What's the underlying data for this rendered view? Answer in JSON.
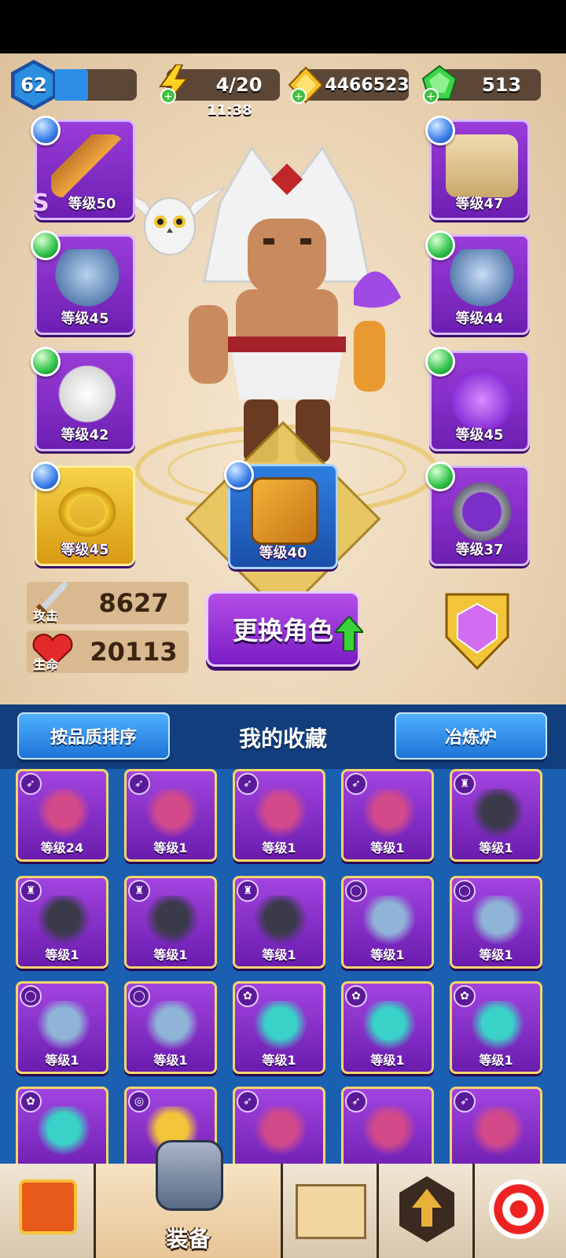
{
  "player": {
    "level": "62",
    "xp_fraction": 0.4
  },
  "resources": {
    "energy": {
      "value": "4/20",
      "timer": "11:38",
      "icon": "energy-bolt-icon"
    },
    "gold": {
      "value": "4466523",
      "icon": "coin-icon"
    },
    "gems": {
      "value": "513",
      "icon": "gem-icon"
    }
  },
  "equipment": {
    "left": [
      {
        "level": "等级50",
        "rarity": "S",
        "icon": "bow-icon",
        "orb": "blue",
        "frame": "purple"
      },
      {
        "level": "等级45",
        "icon": "bull-ring-icon",
        "orb": "green",
        "frame": "purple"
      },
      {
        "level": "等级42",
        "icon": "owl-pet-icon",
        "orb": "green",
        "frame": "purple"
      },
      {
        "level": "等级45",
        "icon": "gold-bracelet-icon",
        "orb": "blue",
        "frame": "gold"
      }
    ],
    "right": [
      {
        "level": "等级47",
        "icon": "armor-icon",
        "orb": "blue",
        "frame": "purple"
      },
      {
        "level": "等级44",
        "icon": "wolf-ring-icon",
        "orb": "green",
        "frame": "purple"
      },
      {
        "level": "等级45",
        "icon": "flame-pet-icon",
        "orb": "green",
        "frame": "purple"
      },
      {
        "level": "等级37",
        "icon": "medallion-icon",
        "orb": "green",
        "frame": "purple"
      }
    ],
    "center": {
      "level": "等级40",
      "icon": "spellbook-icon",
      "orb": "blue",
      "frame": "blue"
    }
  },
  "stats": {
    "attack": {
      "label": "攻击",
      "value": "8627"
    },
    "health": {
      "label": "生命",
      "value": "20113"
    }
  },
  "change_character": "更换角色",
  "collection": {
    "sort_button": "按品质排序",
    "title": "我的收藏",
    "forge_button": "冶炼炉",
    "items": [
      {
        "level": "等级24",
        "type": "bow"
      },
      {
        "level": "等级1",
        "type": "bow"
      },
      {
        "level": "等级1",
        "type": "bow"
      },
      {
        "level": "等级1",
        "type": "bow"
      },
      {
        "level": "等级1",
        "type": "armor"
      },
      {
        "level": "等级1",
        "type": "armor"
      },
      {
        "level": "等级1",
        "type": "armor"
      },
      {
        "level": "等级1",
        "type": "armor"
      },
      {
        "level": "等级1",
        "type": "ring"
      },
      {
        "level": "等级1",
        "type": "ring"
      },
      {
        "level": "等级1",
        "type": "ring"
      },
      {
        "level": "等级1",
        "type": "ring"
      },
      {
        "level": "等级1",
        "type": "pet"
      },
      {
        "level": "等级1",
        "type": "pet"
      },
      {
        "level": "等级1",
        "type": "pet"
      },
      {
        "level": "",
        "type": "pet"
      },
      {
        "level": "",
        "type": "bracelet"
      },
      {
        "level": "",
        "type": "bow"
      },
      {
        "level": "",
        "type": "bow"
      },
      {
        "level": "",
        "type": "bow"
      }
    ]
  },
  "nav": {
    "equipment_label": "装备"
  }
}
